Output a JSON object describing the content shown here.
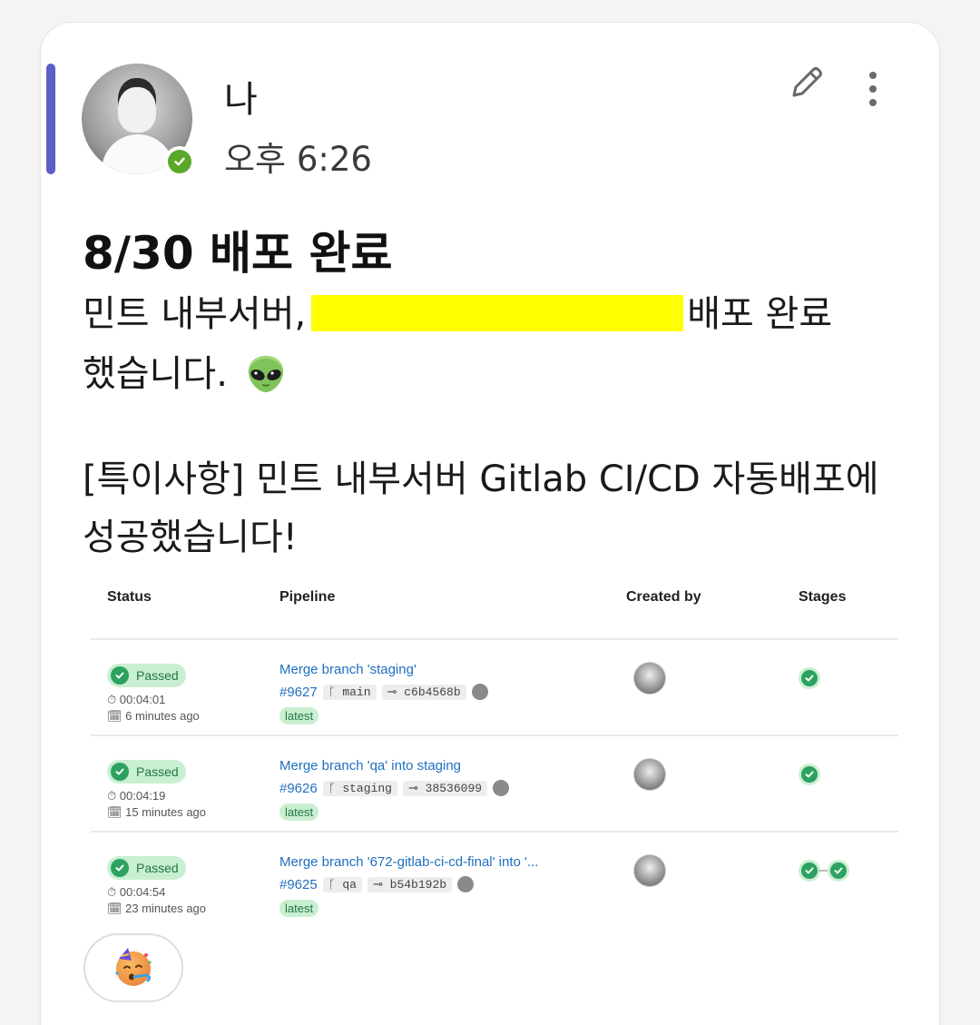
{
  "message": {
    "sender": "나",
    "time": "오후 6:26",
    "title": "8/30 배포 완료",
    "line1_start": "민트 내부서버,",
    "line1_end": "배포 완료",
    "line2": "했습니다.",
    "line3": "[특이사항] 민트 내부서버 Gitlab CI/CD 자동배포에",
    "line4": "성공했습니다!"
  },
  "pipelines_table": {
    "headers": [
      "Status",
      "Pipeline",
      "Created by",
      "Stages"
    ],
    "rows": [
      {
        "status": "Passed",
        "duration": "00:04:01",
        "ago": "6 minutes ago",
        "title": "Merge branch 'staging'",
        "id": "#9627",
        "branch": "main",
        "commit": "c6b4568b",
        "badge": "latest",
        "stages": 1
      },
      {
        "status": "Passed",
        "duration": "00:04:19",
        "ago": "15 minutes ago",
        "title": "Merge branch 'qa' into staging",
        "id": "#9626",
        "branch": "staging",
        "commit": "38536099",
        "badge": "latest",
        "stages": 1
      },
      {
        "status": "Passed",
        "duration": "00:04:54",
        "ago": "23 minutes ago",
        "title": "Merge branch '672-gitlab-ci-cd-final' into '...",
        "id": "#9625",
        "branch": "qa",
        "commit": "b54b192b",
        "badge": "latest",
        "stages": 2
      }
    ]
  },
  "colors": {
    "accent": "#5b5fc7",
    "presence": "#5aa829",
    "passed_bg": "#c9efd1",
    "passed_fg": "#217645",
    "link": "#1f6fbf",
    "redaction": "#ffff00"
  },
  "icons": {
    "edit": "pencil-icon",
    "more": "more-vertical-icon",
    "emoji": "alien-emoji",
    "reaction": "partying-face-emoji"
  }
}
